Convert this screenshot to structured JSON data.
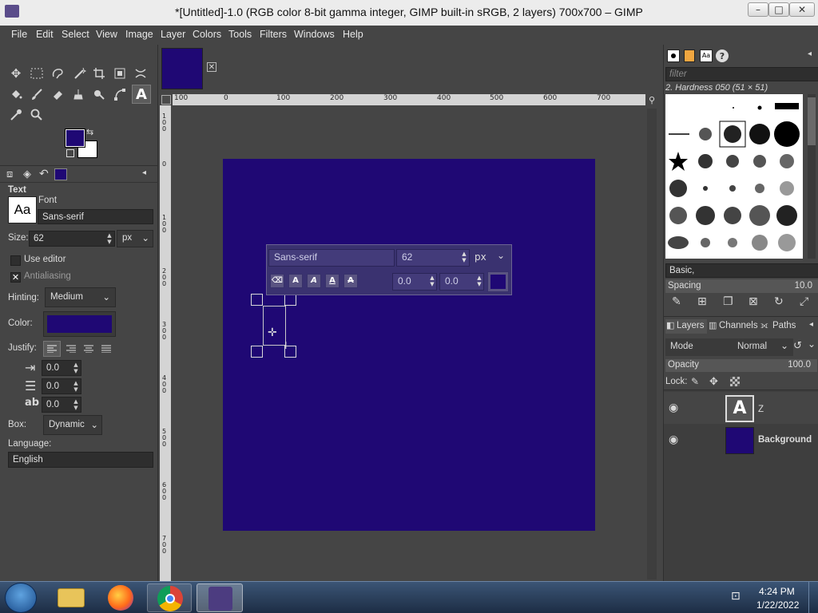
{
  "window": {
    "title": "*[Untitled]-1.0 (RGB color 8-bit gamma integer, GIMP built-in sRGB, 2 layers) 700x700 – GIMP",
    "minimize": "–",
    "maximize": "□",
    "close": "✕"
  },
  "menu": [
    "File",
    "Edit",
    "Select",
    "View",
    "Image",
    "Layer",
    "Colors",
    "Tools",
    "Filters",
    "Windows",
    "Help"
  ],
  "tool_options": {
    "section_title": "Text",
    "font_label": "Font",
    "font_preview": "Aa",
    "font_value": "Sans-serif",
    "size_label": "Size:",
    "size_value": "62",
    "size_unit": "px",
    "use_editor_label": "Use editor",
    "antialiasing_label": "Antialiasing",
    "hinting_label": "Hinting:",
    "hinting_value": "Medium",
    "color_label": "Color:",
    "justify_label": "Justify:",
    "indent_value": "0.0",
    "line_spacing_value": "0.0",
    "letter_spacing_value": "0.0",
    "box_label": "Box:",
    "box_value": "Dynamic",
    "language_label": "Language:",
    "language_value": "English"
  },
  "colors": {
    "foreground": "#1f0874",
    "background": "#ffffff",
    "image_fill": "#1f0874"
  },
  "rulers": {
    "horizontal": [
      "100",
      "0",
      "100",
      "200",
      "300",
      "400",
      "500",
      "600",
      "700"
    ],
    "vertical": [
      "100",
      "0",
      "100",
      "200",
      "300",
      "400",
      "500",
      "600",
      "700"
    ]
  },
  "text_toolbar": {
    "font": "Sans-serif",
    "size": "62",
    "unit": "px",
    "baseline": "0.0",
    "kerning": "0.0",
    "style_buttons": [
      "A",
      "A",
      "A",
      "A"
    ]
  },
  "brushes": {
    "filter_placeholder": "filter",
    "selected_brush": "2. Hardness 050 (51 × 51)",
    "preset": "Basic,",
    "spacing_label": "Spacing",
    "spacing_value": "10.0"
  },
  "layers_panel": {
    "tabs": [
      "Layers",
      "Channels",
      "Paths"
    ],
    "mode_label": "Mode",
    "mode_value": "Normal",
    "opacity_label": "Opacity",
    "opacity_value": "100.0",
    "lock_label": "Lock:",
    "layers": [
      {
        "name": "Z",
        "type": "text"
      },
      {
        "name": "Background",
        "type": "fill"
      }
    ]
  },
  "taskbar": {
    "time": "4:24 PM",
    "date": "1/22/2022"
  }
}
